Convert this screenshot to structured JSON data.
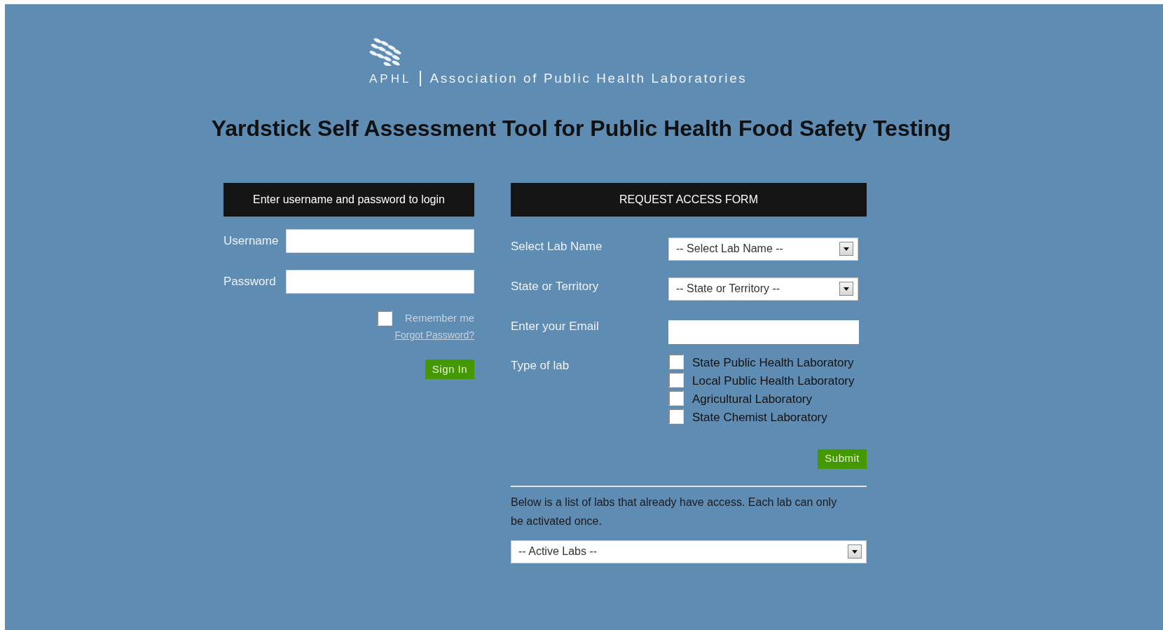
{
  "logo": {
    "abbreviation": "APHL",
    "name": "Association of Public Health Laboratories"
  },
  "title": "Yardstick Self Assessment Tool for Public Health Food Safety Testing",
  "login": {
    "header": "Enter username and password to login",
    "fields": [
      {
        "label": "Username"
      },
      {
        "label": "Password"
      }
    ],
    "remember": {
      "label": "Remember me",
      "checked": false
    },
    "forgot_link": "Forgot Password?",
    "button": "Sign In"
  },
  "request_form": {
    "header": "REQUEST ACCESS FORM",
    "rows": [
      {
        "label": "Select Lab Name",
        "kind": "select",
        "value": "-- Select Lab Name --"
      },
      {
        "label": "State or Territory",
        "kind": "select",
        "value": "-- State or Territory --"
      },
      {
        "label": "Enter your Email",
        "kind": "input"
      }
    ],
    "lab_type": {
      "label": "Type of lab",
      "options": [
        {
          "label": "State Public Health Laboratory",
          "checked": false
        },
        {
          "label": "Local Public Health Laboratory",
          "checked": false
        },
        {
          "label": "Agricultural Laboratory",
          "checked": false
        },
        {
          "label": "State Chemist Laboratory",
          "checked": false
        }
      ]
    },
    "button": "Submit",
    "note": "Below is a list of labs that already have access. Each lab can only be activated once.",
    "active_labs": "-- Active Labs --"
  }
}
